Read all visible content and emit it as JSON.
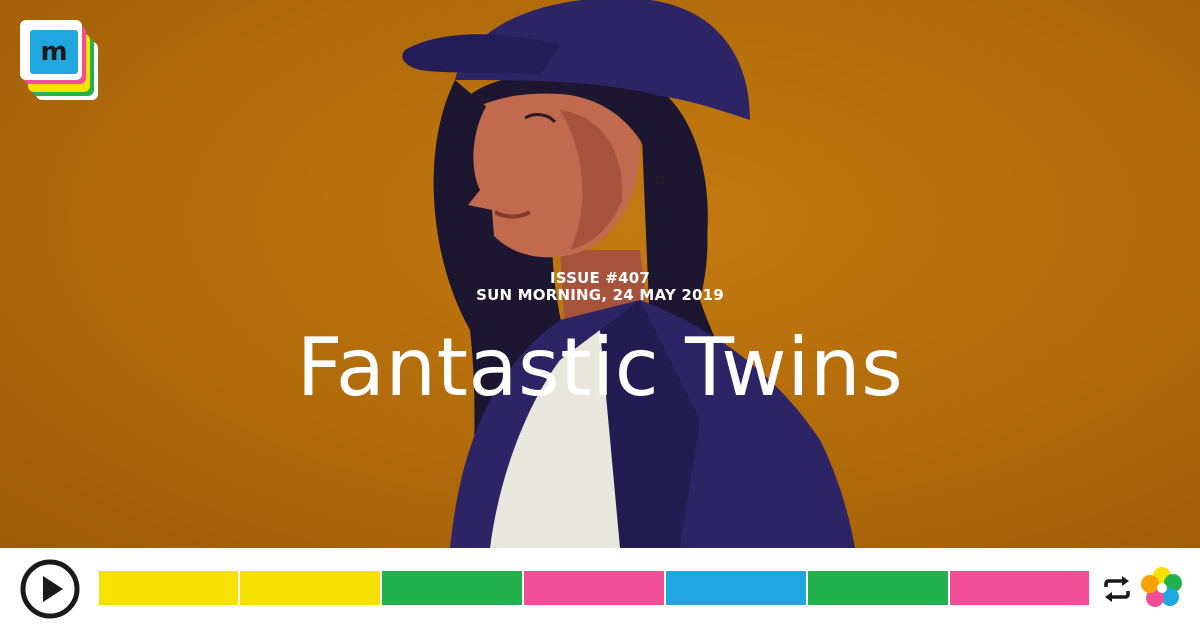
{
  "logo": {
    "text": "m"
  },
  "issue": {
    "number": "ISSUE #407",
    "date": "SUN MORNING, 24 MAY 2019"
  },
  "title": "Fantastic Twins",
  "colors": {
    "background": "#b36a0c",
    "jacket": "#2d2466",
    "skin": "#c26a4e",
    "hair": "#1c1630",
    "yellow": "#f7e100",
    "green": "#22b14c",
    "pink": "#f24d97",
    "blue": "#21a7df"
  },
  "player": {
    "play_icon": "play-icon",
    "repeat_icon": "repeat-icon",
    "segments": [
      {
        "color": "#f7e100"
      },
      {
        "color": "#f7e100"
      },
      {
        "color": "#22b14c"
      },
      {
        "color": "#f24d97"
      },
      {
        "color": "#21a7df"
      },
      {
        "color": "#22b14c"
      },
      {
        "color": "#f24d97"
      }
    ]
  }
}
